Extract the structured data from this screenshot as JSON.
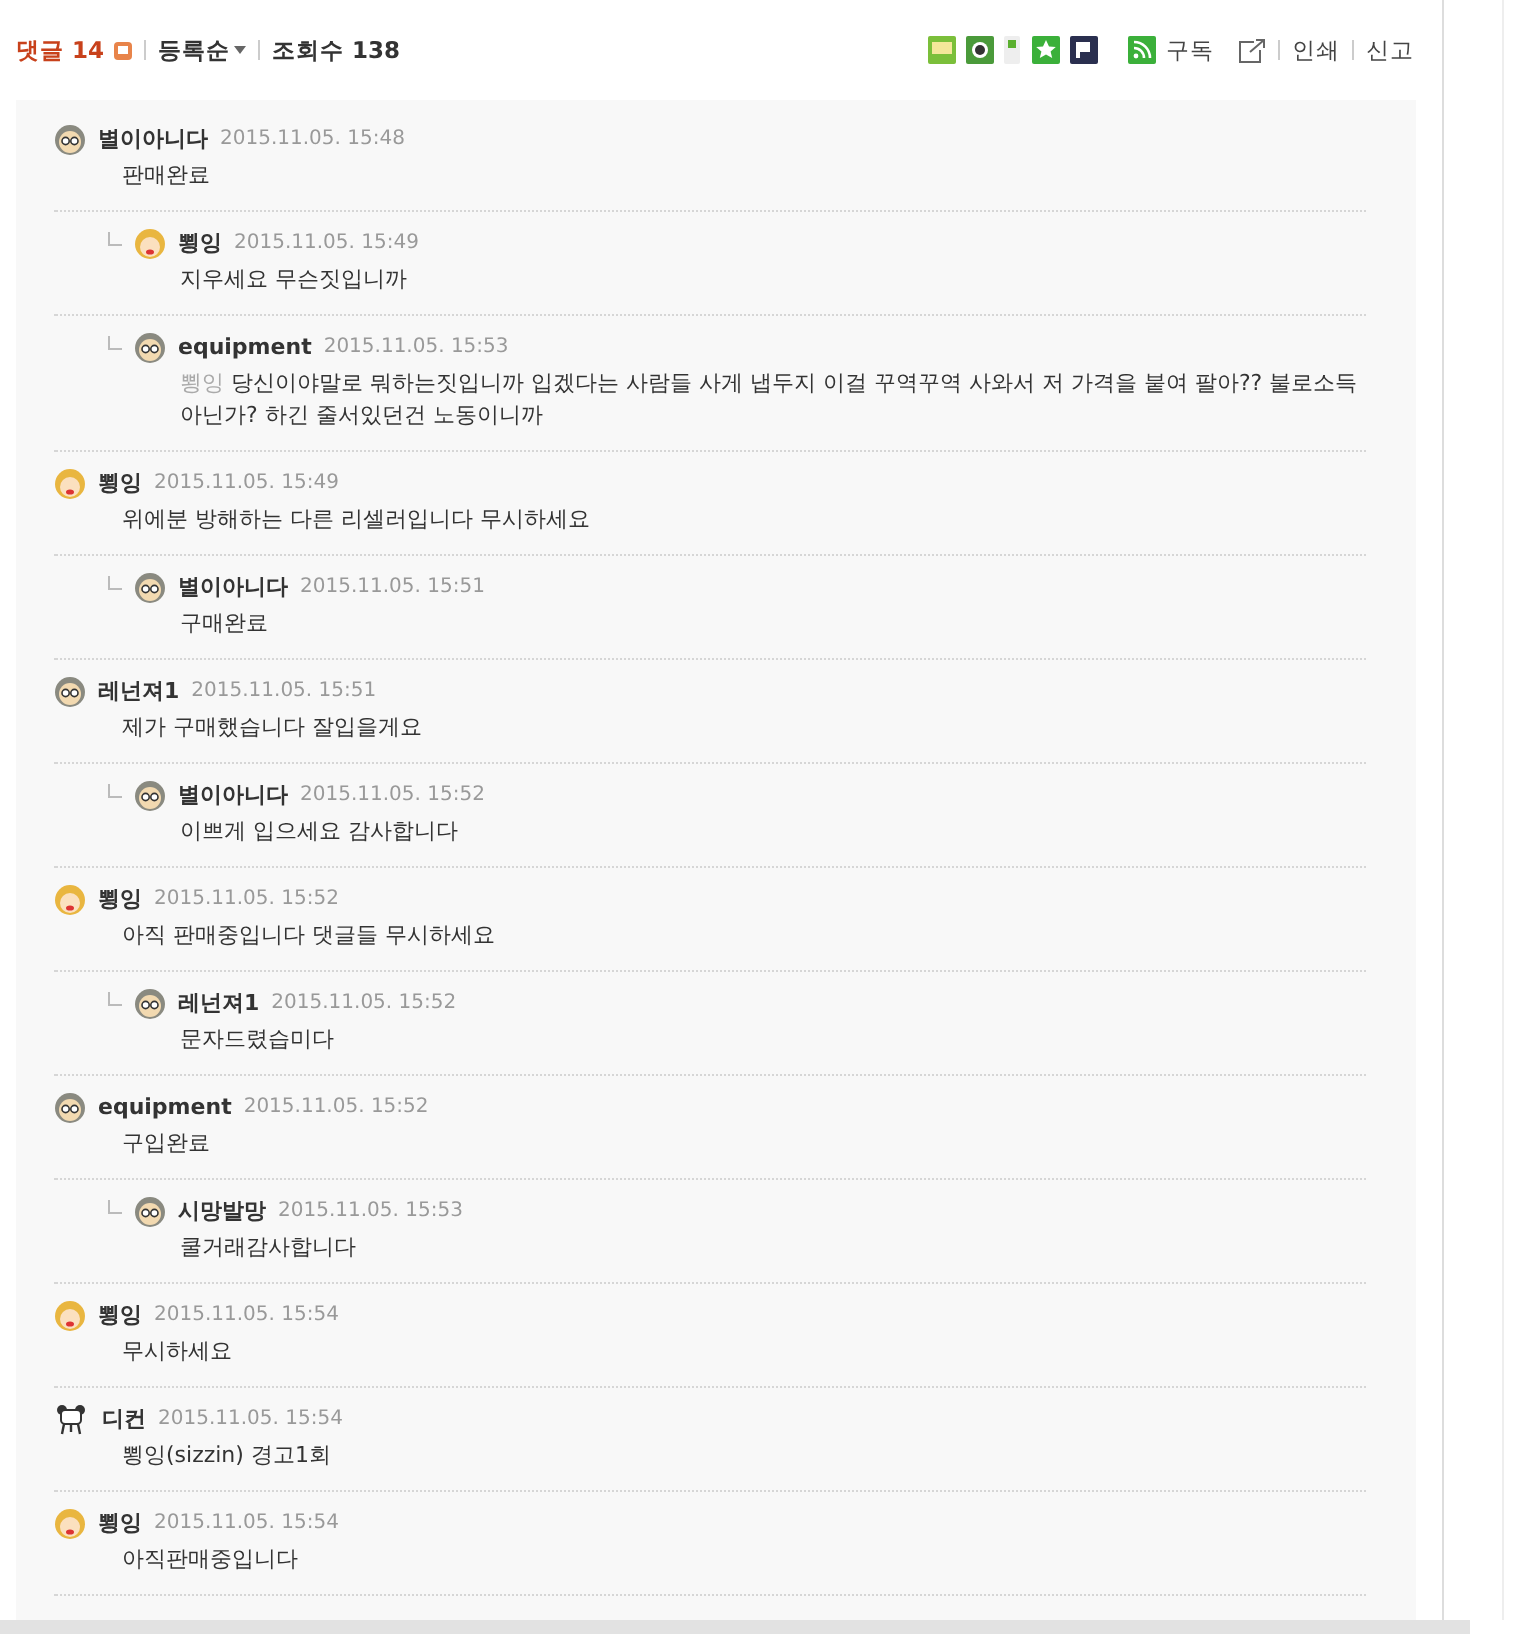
{
  "header": {
    "comment_label": "댓글 14",
    "sort": "등록순",
    "views": "조회수 138",
    "subscribe": "구독",
    "print": "인쇄",
    "report": "신고"
  },
  "comments": [
    {
      "kind": "glasses",
      "author": "별이아니다",
      "time": "2015.11.05. 15:48",
      "text": "판매완료",
      "children": [
        {
          "kind": "blonde",
          "author": "뾩잉",
          "time": "2015.11.05. 15:49",
          "text": "지우세요 무슨짓입니까"
        },
        {
          "kind": "glasses",
          "author": "equipment",
          "time": "2015.11.05. 15:53",
          "mention": "뾩잉",
          "text": "당신이야말로 뭐하는짓입니까 입겠다는 사람들 사게 냅두지 이걸 꾸역꾸역 사와서 저 가격을 붙여 팔아?? 불로소득아닌가? 하긴 줄서있던건 노동이니까"
        }
      ]
    },
    {
      "kind": "blonde",
      "author": "뾩잉",
      "time": "2015.11.05. 15:49",
      "text": "위에분 방해하는 다른 리셀러입니다 무시하세요",
      "children": [
        {
          "kind": "glasses",
          "author": "별이아니다",
          "time": "2015.11.05. 15:51",
          "text": "구매완료"
        }
      ]
    },
    {
      "kind": "glasses",
      "author": "레넌져1",
      "time": "2015.11.05. 15:51",
      "text": "제가 구매했습니다 잘입을게요",
      "children": [
        {
          "kind": "glasses",
          "author": "별이아니다",
          "time": "2015.11.05. 15:52",
          "text": "이쁘게 입으세요 감사합니다"
        }
      ]
    },
    {
      "kind": "blonde",
      "author": "뾩잉",
      "time": "2015.11.05. 15:52",
      "text": "아직 판매중입니다 댓글들 무시하세요",
      "children": [
        {
          "kind": "glasses",
          "author": "레넌져1",
          "time": "2015.11.05. 15:52",
          "text": "문자드렸습미다"
        }
      ]
    },
    {
      "kind": "glasses",
      "author": "equipment",
      "time": "2015.11.05. 15:52",
      "text": "구입완료",
      "children": [
        {
          "kind": "glasses",
          "author": "시망발망",
          "time": "2015.11.05. 15:53",
          "text": "쿨거래감사합니다"
        }
      ]
    },
    {
      "kind": "blonde",
      "author": "뾩잉",
      "time": "2015.11.05. 15:54",
      "text": "무시하세요"
    },
    {
      "kind": "panda",
      "author": "디컨",
      "time": "2015.11.05. 15:54",
      "text": "뾩잉(sizzin) 경고1회"
    },
    {
      "kind": "blonde",
      "author": "뾩잉",
      "time": "2015.11.05. 15:54",
      "text": "아직판매중입니다"
    }
  ]
}
